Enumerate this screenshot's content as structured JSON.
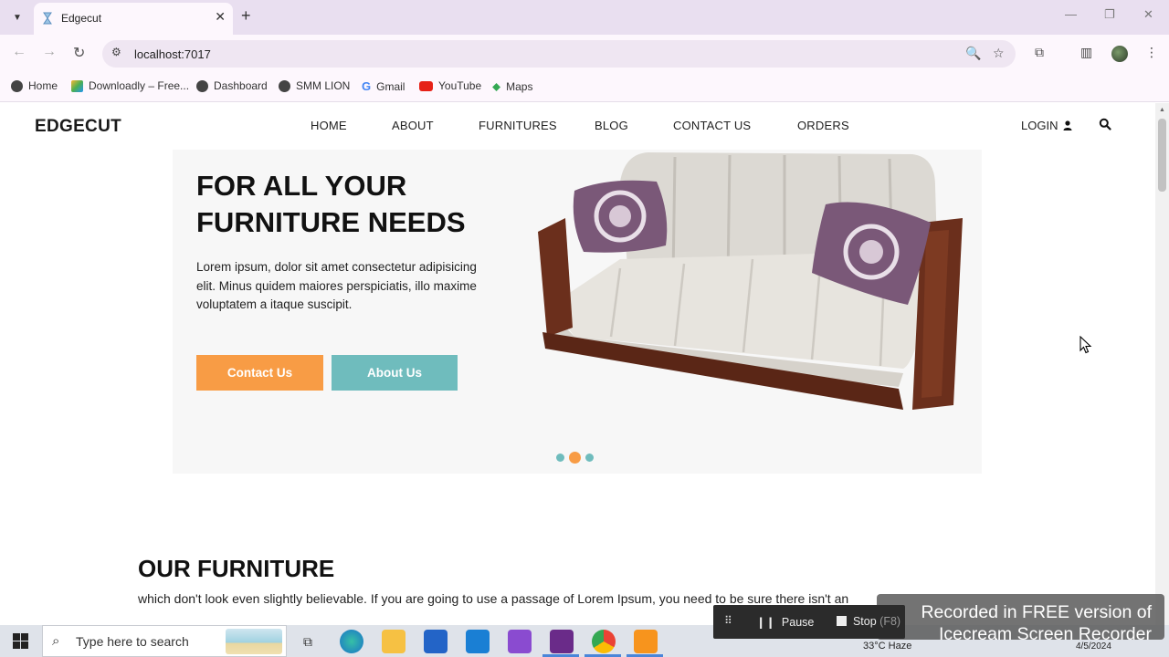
{
  "browser": {
    "tab_title": "Edgecut",
    "url": "localhost:7017",
    "bookmarks": [
      "Home",
      "Downloadly – Free...",
      "Dashboard",
      "SMM LION",
      "Gmail",
      "YouTube",
      "Maps"
    ]
  },
  "site": {
    "logo": "EDGECUT",
    "nav": [
      "HOME",
      "ABOUT",
      "FURNITURES",
      "BLOG",
      "CONTACT US",
      "ORDERS"
    ],
    "login": "LOGIN",
    "hero": {
      "title_line1": "FOR ALL YOUR",
      "title_line2": "FURNITURE NEEDS",
      "text": "Lorem ipsum, dolor sit amet consectetur adipisicing elit. Minus quidem maiores perspiciatis, illo maxime voluptatem a itaque suscipit.",
      "contact_button": "Contact Us",
      "about_button": "About Us",
      "slide_count": 3,
      "active_slide": 2
    },
    "section": {
      "title": "OUR FURNITURE",
      "text": "which don't look even slightly believable. If you are going to use a passage of Lorem Ipsum, you need to be sure there isn't an"
    }
  },
  "recorder": {
    "pause": "Pause",
    "stop": "Stop",
    "shortcut": "(F8)",
    "watermark_line1": "Recorded in FREE version of",
    "watermark_line2": "Icecream  Screen  Recorder"
  },
  "taskbar": {
    "search_placeholder": "Type here to search",
    "weather": "33°C Haze",
    "date": "4/5/2024"
  },
  "colors": {
    "accent_orange": "#f89c45",
    "accent_teal": "#6fbcbd",
    "hero_bg": "#f7f7f7"
  }
}
